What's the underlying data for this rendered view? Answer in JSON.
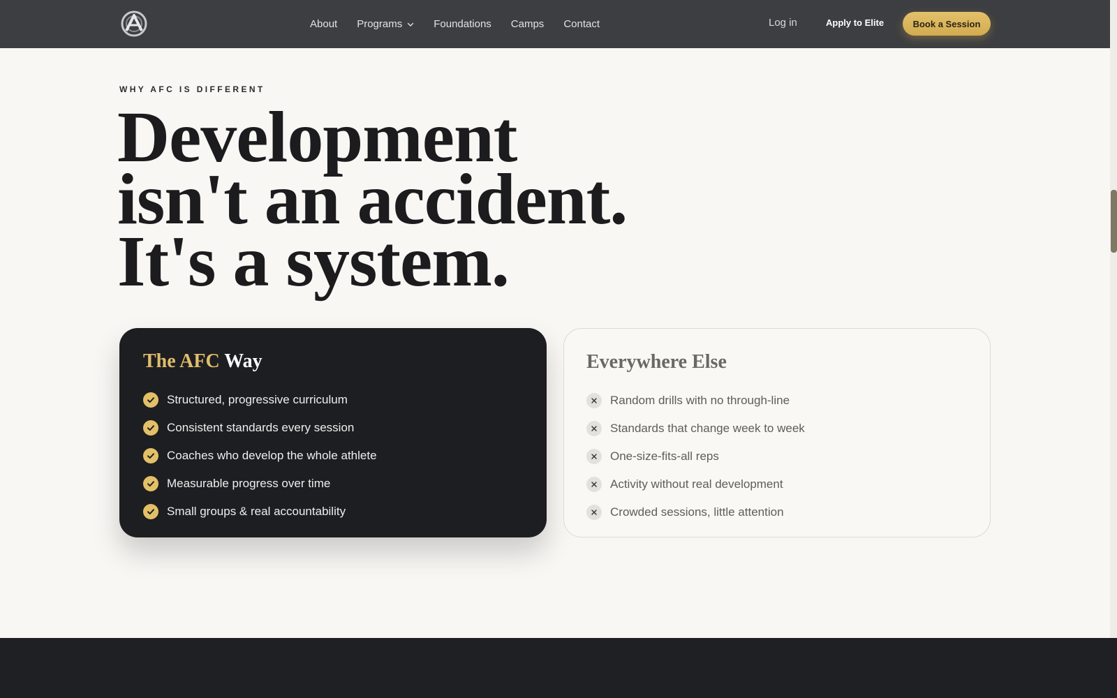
{
  "nav": {
    "links": [
      {
        "label": "About"
      },
      {
        "label": "Programs",
        "has_dropdown": true
      },
      {
        "label": "Foundations"
      },
      {
        "label": "Camps"
      },
      {
        "label": "Contact"
      }
    ],
    "login_label": "Log in",
    "apply_label": "Apply to Elite",
    "book_label": "Book a Session"
  },
  "hero": {
    "eyebrow": "WHY AFC IS DIFFERENT",
    "headline_lines": [
      "Development",
      "isn't an accident.",
      "It's a system."
    ]
  },
  "afc_card": {
    "title_highlight": "The AFC",
    "title_rest": "Way",
    "items": [
      "Structured, progressive curriculum",
      "Consistent standards every session",
      "Coaches who develop the whole athlete",
      "Measurable progress over time",
      "Small groups & real accountability"
    ]
  },
  "else_card": {
    "title": "Everywhere Else",
    "items": [
      "Random drills with no through-line",
      "Standards that change week to week",
      "One-size-fits-all reps",
      "Activity without real development",
      "Crowded sessions, little attention"
    ]
  },
  "colors": {
    "accent_gold": "#e3c068",
    "nav_bg": "#3d3e41",
    "page_bg": "#f8f7f4",
    "dark_card": "#1d1e21"
  },
  "icons": {
    "check": "check-icon",
    "x": "x-icon",
    "chevron": "chevron-down-icon",
    "logo": "afc-logo-icon"
  }
}
